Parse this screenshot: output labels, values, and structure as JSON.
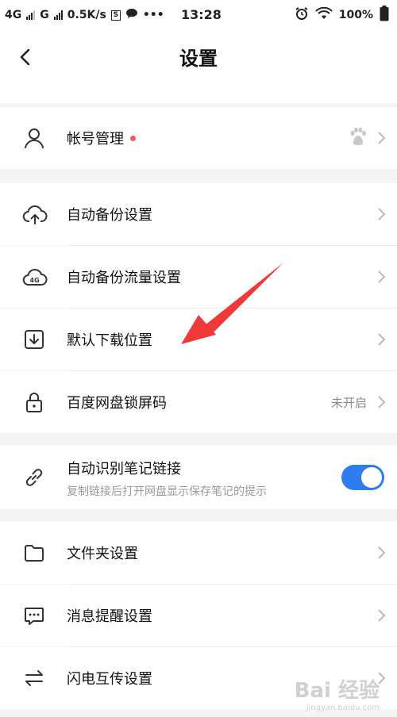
{
  "status_bar": {
    "net1": "4G",
    "net2": "G",
    "speed": "0.5K/s",
    "sbox": "S",
    "more": "•••",
    "time": "13:28",
    "battery": "100%"
  },
  "header": {
    "title": "设置"
  },
  "rows": {
    "account": {
      "label": "帐号管理"
    },
    "auto_backup": {
      "label": "自动备份设置"
    },
    "backup_traffic": {
      "label": "自动备份流量设置"
    },
    "download_location": {
      "label": "默认下载位置"
    },
    "lock_code": {
      "label": "百度网盘锁屏码",
      "value": "未开启"
    },
    "note_link": {
      "label": "自动识别笔记链接",
      "sublabel": "复制链接后打开网盘显示保存笔记的提示",
      "enabled": true
    },
    "folder": {
      "label": "文件夹设置"
    },
    "notify": {
      "label": "消息提醒设置"
    },
    "transfer": {
      "label": "闪电互传设置"
    }
  },
  "icons": [
    "back-icon",
    "user-icon",
    "paw-icon",
    "cloud-upload-icon",
    "cloud-4g-icon",
    "download-icon",
    "lock-icon",
    "link-icon",
    "folder-icon",
    "message-icon",
    "transfer-icon",
    "chevron-right-icon"
  ],
  "colors": {
    "accent": "#2f7bf0",
    "dot": "#f25a5a",
    "arrow": "#f03a3a"
  },
  "watermark": {
    "brand": "Bai 经验",
    "url": "jingyan.baidu.com"
  }
}
